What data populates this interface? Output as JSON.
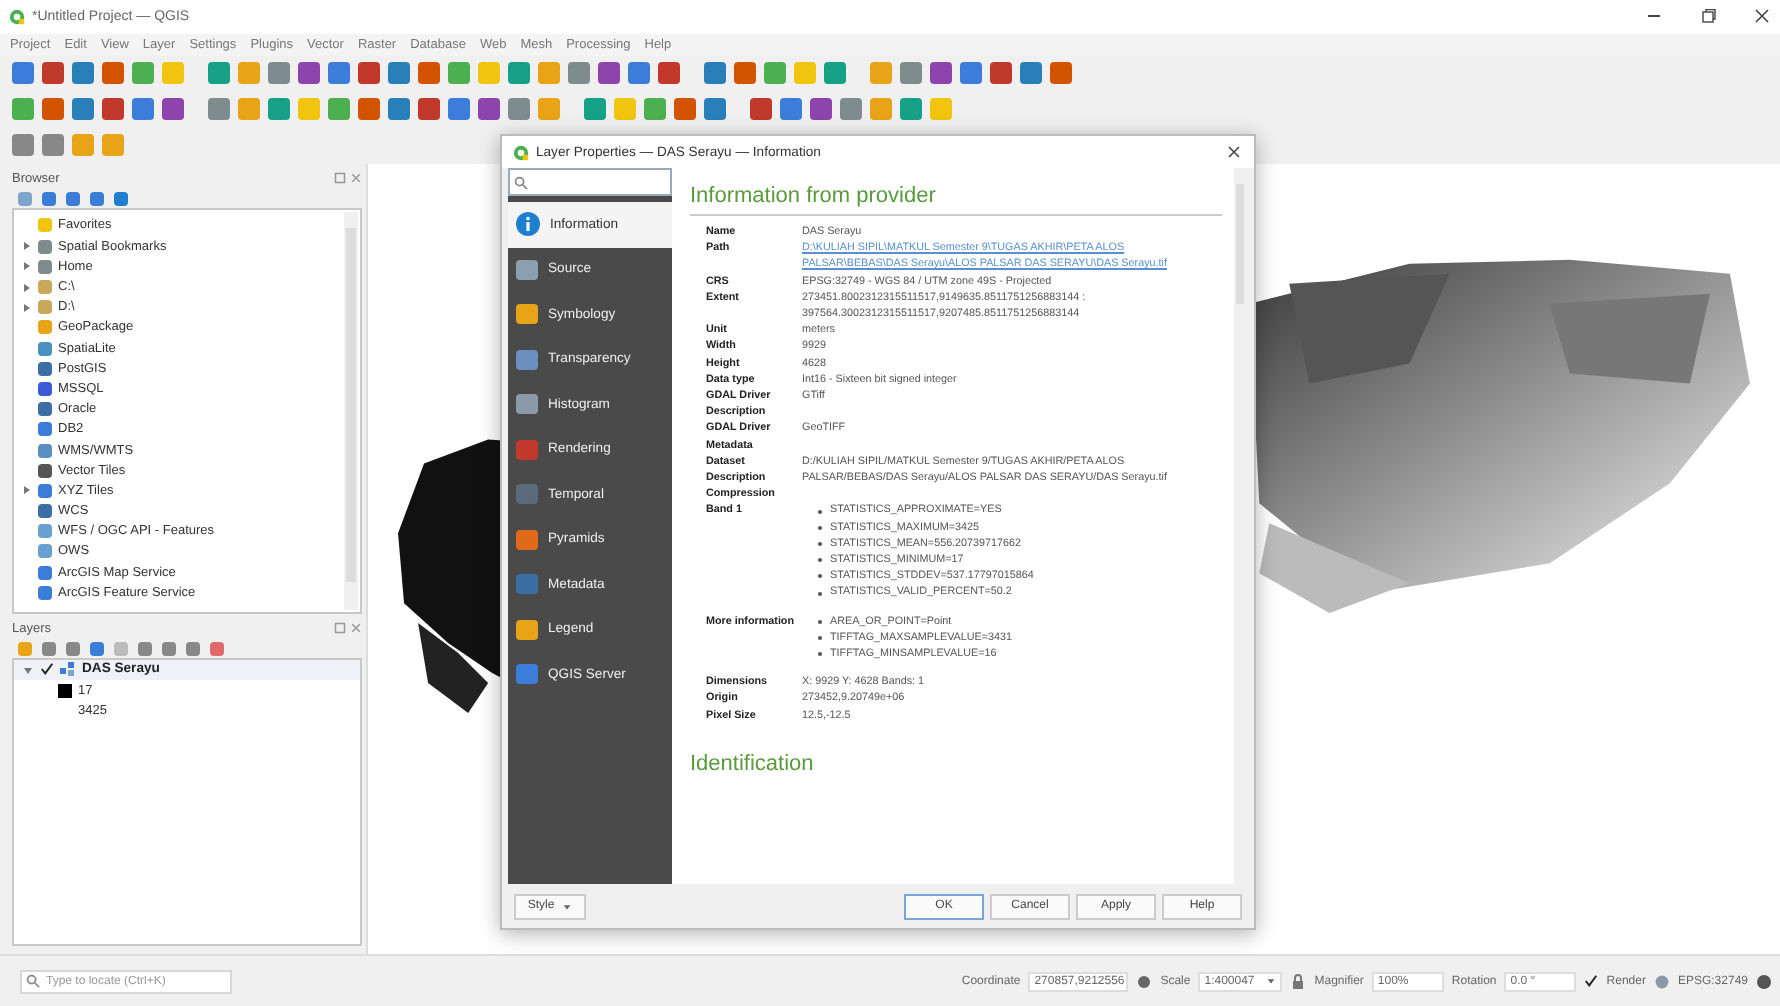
{
  "window": {
    "title": "*Untitled Project — QGIS"
  },
  "menu": [
    "Project",
    "Edit",
    "View",
    "Layer",
    "Settings",
    "Plugins",
    "Vector",
    "Raster",
    "Database",
    "Web",
    "Mesh",
    "Processing",
    "Help"
  ],
  "browser": {
    "title": "Browser",
    "items": [
      {
        "label": "Favorites",
        "expandable": false
      },
      {
        "label": "Spatial Bookmarks",
        "expandable": true
      },
      {
        "label": "Home",
        "expandable": true
      },
      {
        "label": "C:\\",
        "expandable": true
      },
      {
        "label": "D:\\",
        "expandable": true
      },
      {
        "label": "GeoPackage",
        "expandable": false
      },
      {
        "label": "SpatiaLite",
        "expandable": false
      },
      {
        "label": "PostGIS",
        "expandable": false
      },
      {
        "label": "MSSQL",
        "expandable": false
      },
      {
        "label": "Oracle",
        "expandable": false
      },
      {
        "label": "DB2",
        "expandable": false
      },
      {
        "label": "WMS/WMTS",
        "expandable": false
      },
      {
        "label": "Vector Tiles",
        "expandable": false
      },
      {
        "label": "XYZ Tiles",
        "expandable": true
      },
      {
        "label": "WCS",
        "expandable": false
      },
      {
        "label": "WFS / OGC API - Features",
        "expandable": false
      },
      {
        "label": "OWS",
        "expandable": false
      },
      {
        "label": "ArcGIS Map Service",
        "expandable": false
      },
      {
        "label": "ArcGIS Feature Service",
        "expandable": false
      }
    ]
  },
  "layers": {
    "title": "Layers",
    "items": [
      {
        "name": "DAS Serayu",
        "checked": true,
        "expanded": true,
        "legend": [
          {
            "label": "17",
            "color": "#000000"
          },
          {
            "label": "3425"
          }
        ]
      }
    ]
  },
  "dialog": {
    "title": "Layer Properties — DAS Serayu — Information",
    "tabs": [
      {
        "label": "Information",
        "selected": true
      },
      {
        "label": "Source",
        "selected": false
      },
      {
        "label": "Symbology",
        "selected": false
      },
      {
        "label": "Transparency",
        "selected": false
      },
      {
        "label": "Histogram",
        "selected": false
      },
      {
        "label": "Rendering",
        "selected": false
      },
      {
        "label": "Temporal",
        "selected": false
      },
      {
        "label": "Pyramids",
        "selected": false
      },
      {
        "label": "Metadata",
        "selected": false
      },
      {
        "label": "Legend",
        "selected": false
      },
      {
        "label": "QGIS Server",
        "selected": false
      }
    ],
    "heading": "Information from provider",
    "rows": [
      {
        "key": "Name",
        "value": "DAS Serayu"
      },
      {
        "key": "Path",
        "link": "D:\\KULIAH SIPIL\\MATKUL Semester 9\\TUGAS AKHIR\\PETA ALOS PALSAR\\BEBAS\\DAS Serayu\\ALOS PALSAR DAS SERAYU\\DAS Serayu.tif"
      },
      {
        "key": "CRS",
        "value": "EPSG:32749 - WGS 84 / UTM zone 49S - Projected"
      },
      {
        "key": "Extent",
        "value": "273451.8002312315511517,9149635.8511751256883144 : 397564.3002312315511517,9207485.8511751256883144"
      },
      {
        "key": "Unit",
        "value": "meters"
      },
      {
        "key": "Width",
        "value": "9929"
      },
      {
        "key": "Height",
        "value": "4628"
      },
      {
        "key": "Data type",
        "value": "Int16 - Sixteen bit signed integer"
      },
      {
        "key": "GDAL Driver Description",
        "value": "GTiff"
      },
      {
        "key": "GDAL Driver Metadata",
        "value": "GeoTIFF"
      },
      {
        "key": "Dataset Description",
        "value": "D:/KULIAH SIPIL/MATKUL Semester 9/TUGAS AKHIR/PETA ALOS PALSAR/BEBAS/DAS Serayu/ALOS PALSAR DAS SERAYU/DAS Serayu.tif"
      },
      {
        "key": "Compression"
      },
      {
        "key": "Band 1",
        "items": [
          "STATISTICS_APPROXIMATE=YES",
          "STATISTICS_MAXIMUM=3425",
          "STATISTICS_MEAN=556.20739717662",
          "STATISTICS_MINIMUM=17",
          "STATISTICS_STDDEV=537.17797015864",
          "STATISTICS_VALID_PERCENT=50.2"
        ]
      },
      {
        "key": "More information",
        "items": [
          "AREA_OR_POINT=Point",
          "TIFFTAG_MAXSAMPLEVALUE=3431",
          "TIFFTAG_MINSAMPLEVALUE=16"
        ]
      },
      {
        "key": "Dimensions",
        "value": "X: 9929 Y: 4628 Bands: 1"
      },
      {
        "key": "Origin",
        "value": "273452,9.20749e+06"
      },
      {
        "key": "Pixel Size",
        "value": "12.5,-12.5"
      }
    ],
    "next_heading": "Identification",
    "style_button": "Style",
    "buttons": [
      "OK",
      "Cancel",
      "Apply",
      "Help"
    ]
  },
  "status_bar": {
    "locate_placeholder": "Type to locate (Ctrl+K)",
    "coordinate_label": "Coordinate",
    "coordinate": "270857,9212556",
    "scale_label": "Scale",
    "scale": "1:400047",
    "magnifier_label": "Magnifier",
    "magnifier": "100%",
    "rotation_label": "Rotation",
    "rotation": "0.0 °",
    "render": {
      "label": "Render",
      "checked": true
    },
    "crs": "EPSG:32749"
  }
}
